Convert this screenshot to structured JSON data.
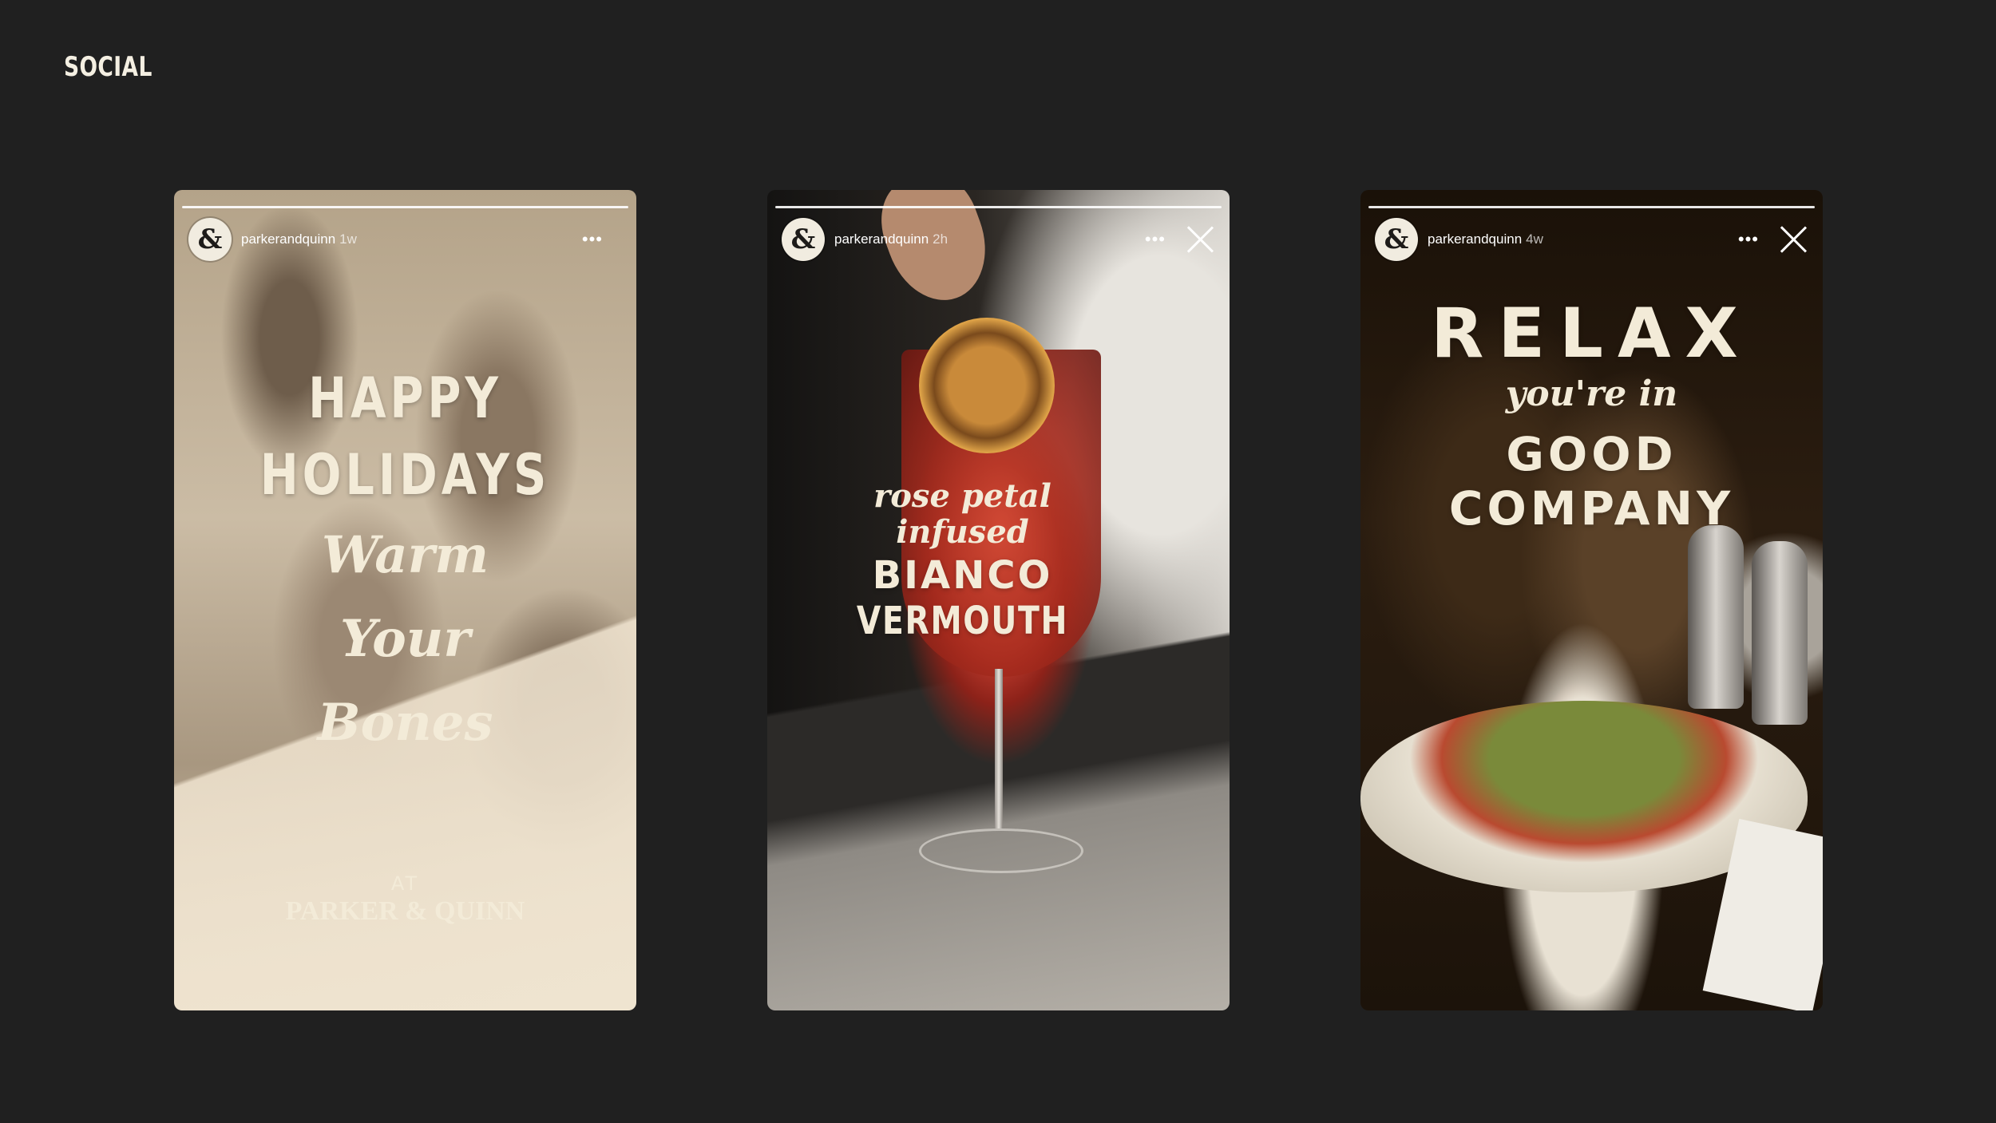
{
  "section_title": "SOCIAL",
  "stories": [
    {
      "handle": "parkerandquinn",
      "time_ago": "1w",
      "avatar_glyph": "&",
      "headline": [
        "HAPPY",
        "HOLIDAYS"
      ],
      "script_lines": [
        "Warm",
        "Your",
        "Bones"
      ],
      "footer_small": "AT",
      "footer_brand": "PARKER & QUINN"
    },
    {
      "handle": "parkerandquinn",
      "time_ago": "2h",
      "avatar_glyph": "&",
      "script_lines": [
        "rose petal",
        "infused"
      ],
      "headline": [
        "BIANCO",
        "VERMOUTH"
      ]
    },
    {
      "handle": "parkerandquinn",
      "time_ago": "4w",
      "avatar_glyph": "&",
      "headline_top": "RELAX",
      "script_line": "you're in",
      "headline": [
        "GOOD",
        "COMPANY"
      ]
    }
  ],
  "icons": {
    "more": "more-horizontal-icon",
    "close": "close-icon"
  }
}
